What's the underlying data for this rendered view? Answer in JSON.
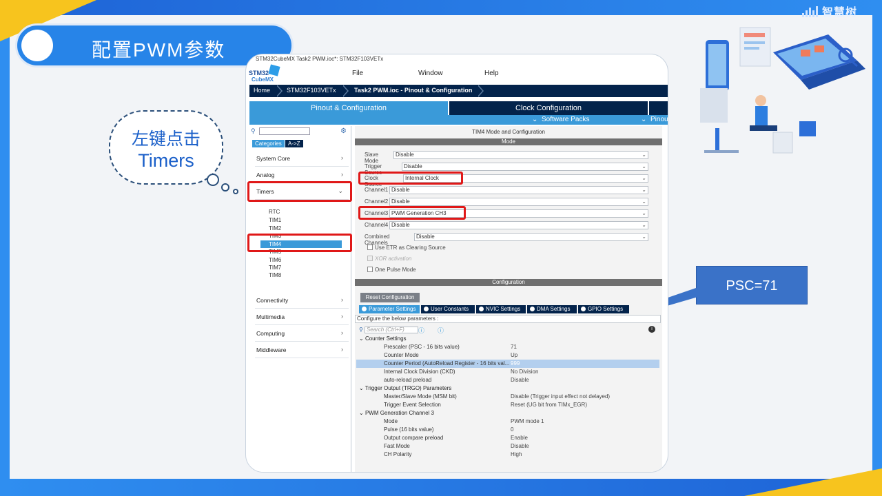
{
  "slide": {
    "title": "配置PWM参数",
    "brand": "智慧树",
    "bubble_line1": "左键点击",
    "bubble_line2": "Timers",
    "callout": "PSC=71"
  },
  "window": {
    "title": "STM32CubeMX Task2 PWM.ioc*: STM32F103VETx",
    "logo_top": "STM32",
    "logo_bottom": "CubeMX",
    "menu": [
      "File",
      "Window",
      "Help"
    ],
    "breadcrumb": [
      "Home",
      "STM32F103VETx",
      "Task2 PWM.ioc - Pinout & Configuration"
    ],
    "tabs": [
      "Pinout & Configuration",
      "Clock Configuration"
    ],
    "subtabs": [
      "Software Packs",
      "Pinout"
    ]
  },
  "left": {
    "segments": [
      "Categories",
      "A->Z"
    ],
    "categories": [
      "System Core",
      "Analog",
      "Timers",
      "Connectivity",
      "Multimedia",
      "Computing",
      "Middleware"
    ],
    "timers": [
      "RTC",
      "TIM1",
      "TIM2",
      "TIM3",
      "TIM4",
      "TIM5",
      "TIM6",
      "TIM7",
      "TIM8"
    ],
    "selected_timer": "TIM4"
  },
  "right": {
    "panel_title": "TIM4 Mode and Configuration",
    "mode_header": "Mode",
    "mode_rows": [
      {
        "label": "Slave Mode",
        "value": "Disable"
      },
      {
        "label": "Trigger Source",
        "value": "Disable"
      },
      {
        "label": "Clock Source",
        "value": "Internal Clock"
      },
      {
        "label": "Channel1",
        "value": "Disable"
      },
      {
        "label": "Channel2",
        "value": "Disable"
      },
      {
        "label": "Channel3",
        "value": "PWM Generation CH3"
      },
      {
        "label": "Channel4",
        "value": "Disable"
      },
      {
        "label": "Combined Channels",
        "value": "Disable"
      }
    ],
    "checks": [
      "Use ETR as Clearing Source",
      "XOR activation",
      "One Pulse Mode"
    ],
    "config_header": "Configuration",
    "reset_button": "Reset Configuration",
    "param_tabs": [
      "Parameter Settings",
      "User Constants",
      "NVIC Settings",
      "DMA Settings",
      "GPIO Settings"
    ],
    "configure_line": "Configure the below parameters :",
    "search_placeholder": "Search (Ctrl+F)",
    "groups": [
      {
        "name": "Counter Settings",
        "params": [
          {
            "name": "Prescaler (PSC - 16 bits value)",
            "value": "71"
          },
          {
            "name": "Counter Mode",
            "value": "Up"
          },
          {
            "name": "Counter Period (AutoReload Register - 16 bits val...",
            "value": "999"
          },
          {
            "name": "Internal Clock Division (CKD)",
            "value": "No Division"
          },
          {
            "name": "auto-reload preload",
            "value": "Disable"
          }
        ]
      },
      {
        "name": "Trigger Output (TRGO) Parameters",
        "params": [
          {
            "name": "Master/Slave Mode (MSM bit)",
            "value": "Disable (Trigger input effect not delayed)"
          },
          {
            "name": "Trigger Event Selection",
            "value": "Reset (UG bit from TIMx_EGR)"
          }
        ]
      },
      {
        "name": "PWM Generation Channel 3",
        "params": [
          {
            "name": "Mode",
            "value": "PWM mode 1"
          },
          {
            "name": "Pulse (16 bits value)",
            "value": "0"
          },
          {
            "name": "Output compare preload",
            "value": "Enable"
          },
          {
            "name": "Fast Mode",
            "value": "Disable"
          },
          {
            "name": "CH Polarity",
            "value": "High"
          }
        ]
      }
    ]
  },
  "colors": {
    "accent": "#3a9ad9",
    "navy": "#03234b",
    "highlight": "#e01818"
  }
}
